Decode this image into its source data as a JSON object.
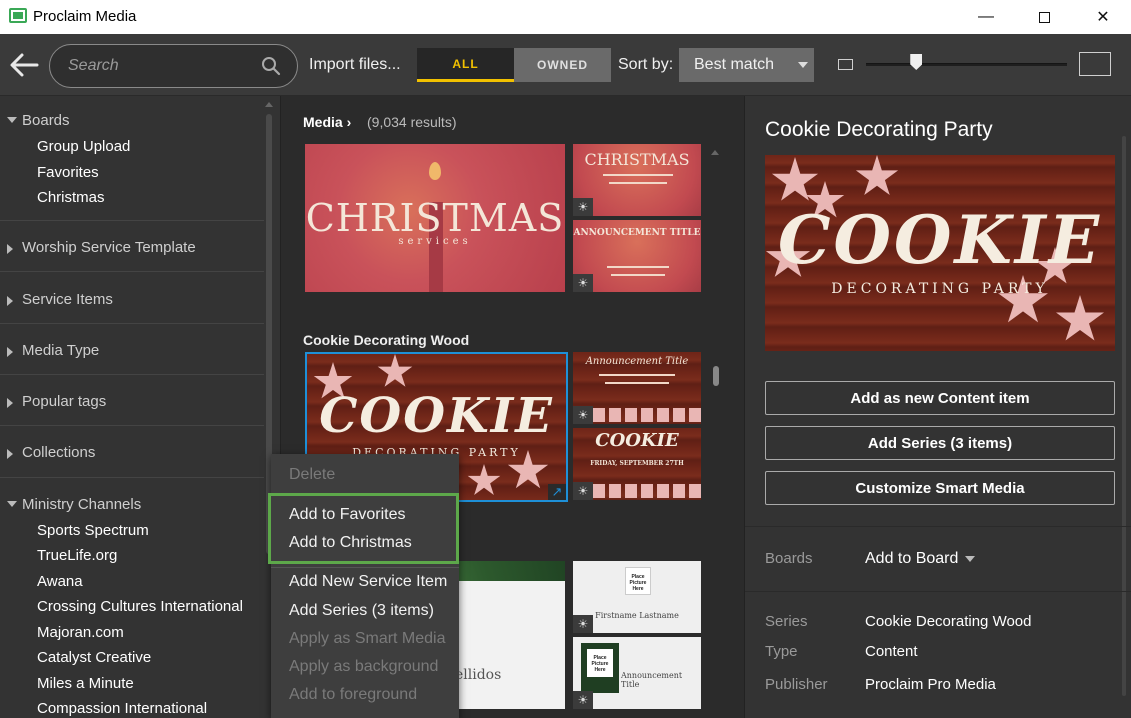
{
  "window": {
    "title": "Proclaim Media"
  },
  "toolbar": {
    "search_placeholder": "Search",
    "import_label": "Import files...",
    "filter_all": "ALL",
    "filter_owned": "OWNED",
    "sort_label": "Sort by:",
    "sort_value": "Best match",
    "thumbnail_size": 0.25
  },
  "sidebar": {
    "boards": {
      "label": "Boards",
      "items": [
        "Group Upload",
        "Favorites",
        "Christmas"
      ]
    },
    "sections": [
      "Worship Service Template",
      "Service Items",
      "Media Type",
      "Popular tags",
      "Collections"
    ],
    "ministry": {
      "label": "Ministry Channels",
      "items": [
        "Sports Spectrum",
        "TrueLife.org",
        "Awana",
        "Crossing Cultures International",
        "Majoran.com",
        "Catalyst Creative",
        "Miles a Minute",
        "Compassion International"
      ]
    }
  },
  "gallery": {
    "breadcrumb": "Media",
    "results": "(9,034 results)",
    "group2_title": "Cookie Decorating Wood",
    "thumbs": {
      "xmas_title": "CHRISTMAS",
      "xmas_sub": "services",
      "xmas_small_title": "CHRISTMAS",
      "announcement": "ANNOUNCEMENT TITLE",
      "cookie": "COOKIE",
      "cookie_sub": "DECORATING PARTY",
      "cookie_ann": "Announcement Title",
      "cookie_small": "COOKIE",
      "cookie_date": "FRIDAY, SEPTEMBER 27TH",
      "name_card": "Firstname Lastname",
      "place_picture": "Place Picture Here",
      "ann_card": "Announcement Title",
      "apellidos": "ellidos"
    }
  },
  "context_menu": {
    "delete": "Delete",
    "add_favorites": "Add to Favorites",
    "add_christmas": "Add to Christmas",
    "add_service_item": "Add New Service Item",
    "add_series": "Add Series (3 items)",
    "apply_smart": "Apply as Smart Media",
    "apply_background": "Apply as background",
    "add_foreground": "Add to foreground"
  },
  "detail": {
    "title": "Cookie Decorating Party",
    "btn_add_content": "Add as new Content item",
    "btn_add_series": "Add Series (3 items)",
    "btn_customize": "Customize Smart Media",
    "boards_key": "Boards",
    "boards_value": "Add to Board",
    "series_key": "Series",
    "series_value": "Cookie Decorating Wood",
    "type_key": "Type",
    "type_value": "Content",
    "publisher_key": "Publisher",
    "publisher_value": "Proclaim Pro Media"
  },
  "colors": {
    "accent": "#f2c100",
    "highlight": "#5da84a",
    "selection": "#1e90d8"
  }
}
